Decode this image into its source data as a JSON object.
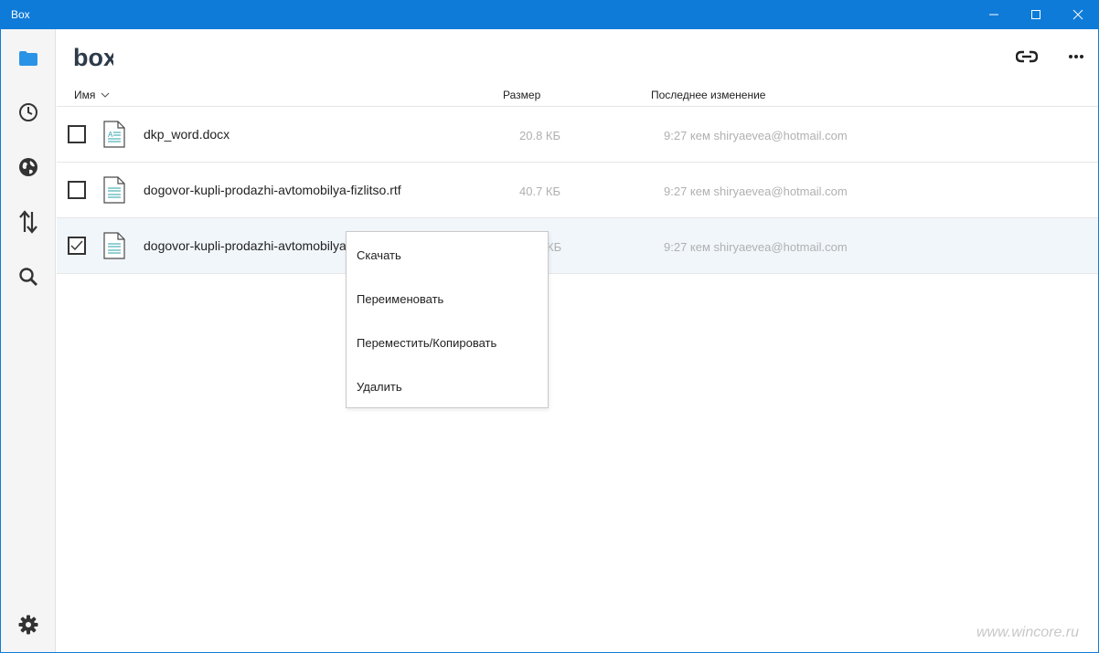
{
  "window": {
    "title": "Box",
    "controls": [
      "minimize",
      "maximize",
      "close"
    ]
  },
  "sidebar": {
    "items": [
      {
        "name": "folder-icon",
        "active": true
      },
      {
        "name": "clock-icon",
        "active": false
      },
      {
        "name": "globe-icon",
        "active": false
      },
      {
        "name": "transfer-arrows-icon",
        "active": false
      },
      {
        "name": "search-icon",
        "active": false
      }
    ],
    "settings": "gear-icon"
  },
  "header": {
    "logo_text": "box",
    "actions": [
      "link-icon",
      "more-icon"
    ]
  },
  "columns": {
    "name": "Имя",
    "size": "Размер",
    "modified": "Последнее изменение"
  },
  "files": [
    {
      "name": "dkp_word.docx",
      "size": "20.8 КБ",
      "modified": "9:27 кем shiryaevea@hotmail.com",
      "checked": false
    },
    {
      "name": "dogovor-kupli-prodazhi-avtomobilya-fizlitso.rtf",
      "size": "40.7 КБ",
      "modified": "9:27 кем shiryaevea@hotmail.com",
      "checked": false
    },
    {
      "name": "dogovor-kupli-prodazhi-avtomobilya",
      "size": "КБ",
      "modified": "9:27 кем shiryaevea@hotmail.com",
      "checked": true
    }
  ],
  "context_menu": {
    "items": [
      "Скачать",
      "Переименовать",
      "Переместить/Копировать",
      "Удалить"
    ]
  },
  "watermark": "www.wincore.ru",
  "colors": {
    "titlebar": "#0f7bd8",
    "accent": "#2a93e6",
    "selected_row": "#f1f6fb"
  }
}
